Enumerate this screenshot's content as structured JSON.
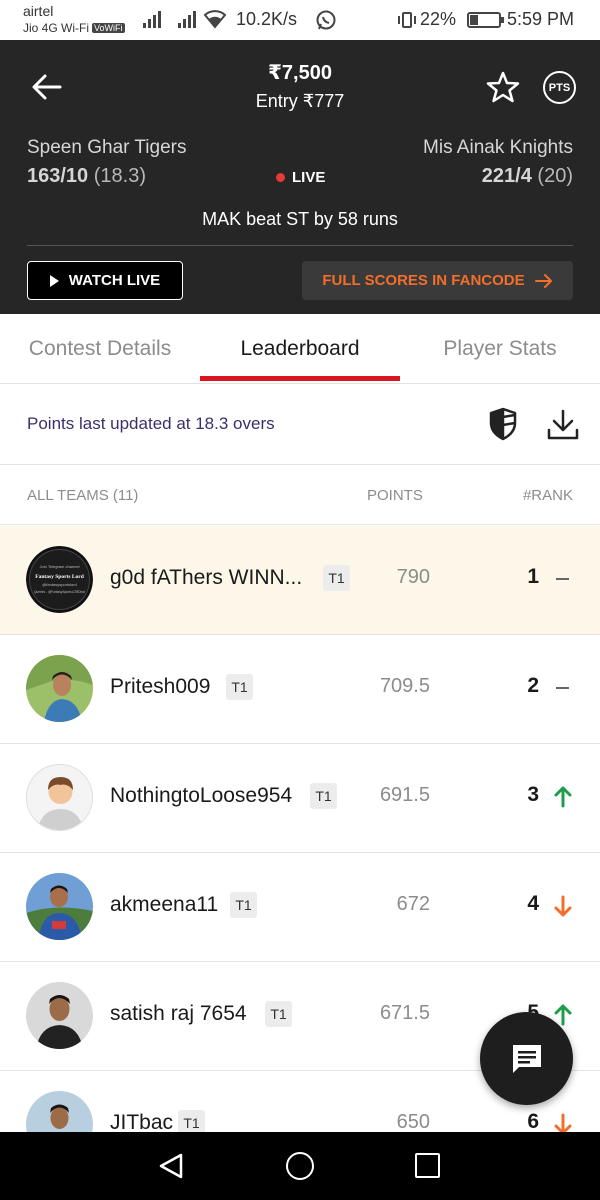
{
  "status_bar": {
    "carrier": "airtel",
    "carrier2": "Jio 4G Wi-Fi",
    "vowifi": "VoWiFi",
    "speed": "10.2K/s",
    "battery": "22%",
    "time": "5:59 PM"
  },
  "match": {
    "prize": "₹7,500",
    "entry": "Entry ₹777",
    "pts_label": "PTS",
    "team_left": {
      "name": "Speen Ghar Tigers",
      "score": "163/10",
      "overs": "(18.3)"
    },
    "team_right": {
      "name": "Mis Ainak Knights",
      "score": "221/4",
      "overs": "(20)"
    },
    "live_label": "LIVE",
    "result": "MAK beat ST by 58 runs",
    "watch_live_label": "WATCH LIVE",
    "full_scores_label": "FULL SCORES IN FANCODE"
  },
  "tabs": [
    {
      "label": "Contest Details"
    },
    {
      "label": "Leaderboard"
    },
    {
      "label": "Player Stats"
    }
  ],
  "points_updated": "Points last updated at 18.3 overs",
  "leaderboard": {
    "header": {
      "teams": "ALL TEAMS (11)",
      "points": "POINTS",
      "rank": "#RANK"
    },
    "rows": [
      {
        "name": "g0d fAThers WINN...",
        "tag": "T1",
        "points": "790",
        "rank": "1",
        "trend": "same",
        "avatar": "fantasy-sports-lord-logo"
      },
      {
        "name": "Pritesh009",
        "tag": "T1",
        "points": "709.5",
        "rank": "2",
        "trend": "same",
        "avatar": "user-photo"
      },
      {
        "name": "NothingtoLoose954",
        "tag": "T1",
        "points": "691.5",
        "rank": "3",
        "trend": "up",
        "avatar": "default-avatar"
      },
      {
        "name": "akmeena11",
        "tag": "T1",
        "points": "672",
        "rank": "4",
        "trend": "down",
        "avatar": "user-photo"
      },
      {
        "name": "satish raj 7654",
        "tag": "T1",
        "points": "671.5",
        "rank": "5",
        "trend": "up",
        "avatar": "user-photo"
      },
      {
        "name": "JITbac",
        "tag": "T1",
        "points": "650",
        "rank": "6",
        "trend": "down",
        "avatar": "user-photo"
      }
    ]
  },
  "logo_text": {
    "line1": "Join Telegram channel",
    "line2": "Fantasy Sports Lord",
    "line3": "@fantasysportslord",
    "line4": "Queries - @FantasySportsLORDbot"
  },
  "colors": {
    "header_bg": "#262626",
    "accent_red": "#d7161f",
    "fancode_orange": "#f26e2a",
    "trend_up": "#1e9e4a",
    "trend_down": "#f26e2a",
    "highlight_row": "#fcf7e8"
  }
}
